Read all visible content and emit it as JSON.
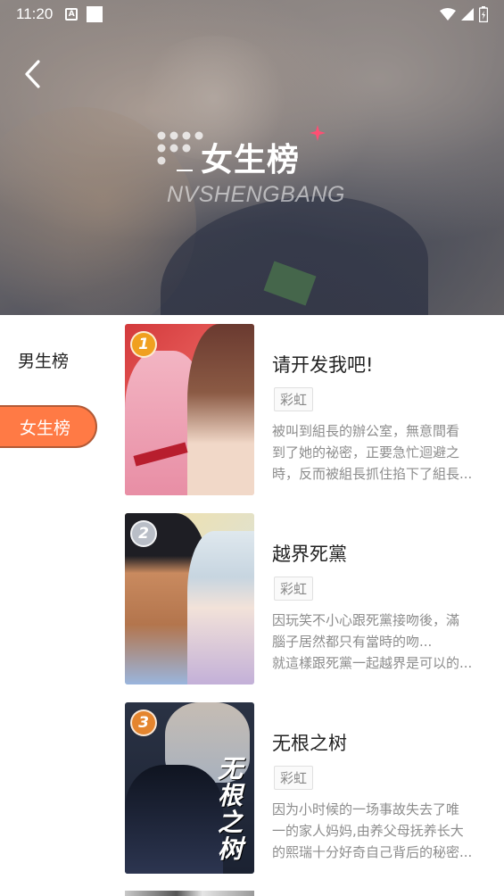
{
  "status_bar": {
    "time": "11:20",
    "a_icon": "A"
  },
  "header": {
    "title": "女生榜",
    "subtitle": "NVSHENGBANG"
  },
  "tabs": [
    {
      "label": "男生榜",
      "active": false
    },
    {
      "label": "女生榜",
      "active": true
    }
  ],
  "books": [
    {
      "rank": "1",
      "title": "请开发我吧!",
      "tag": "彩虹",
      "desc_lines": [
        "被叫到組長的辦公室，無意間看",
        "到了她的祕密，正要急忙迴避之",
        "時，反而被組長抓住掐下了組長..."
      ]
    },
    {
      "rank": "2",
      "title": "越界死黨",
      "tag": "彩虹",
      "desc_lines": [
        "因玩笑不小心跟死黨接吻後，滿",
        "腦子居然都只有當時的吻...",
        "就這樣跟死黨一起越界是可以的..."
      ]
    },
    {
      "rank": "3",
      "title": "无根之树",
      "tag": "彩虹",
      "cover_text": "无根之树",
      "desc_lines": [
        "因为小时候的一场事故失去了唯",
        "一的家人妈妈,由养父母抚养长大",
        "的熙瑞十分好奇自己背后的秘密..."
      ]
    }
  ],
  "colors": {
    "accent": "#ff7a45",
    "gold_badge": "#f0a020",
    "silver_badge": "#b9bec7",
    "bronze_badge": "#e4852f"
  }
}
